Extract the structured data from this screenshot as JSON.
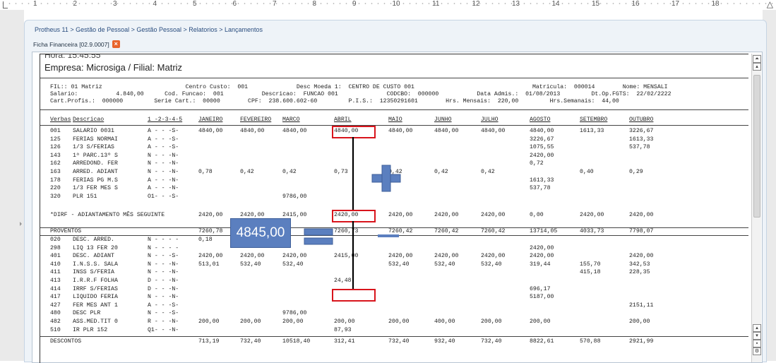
{
  "ruler": {
    "labels": [
      "1",
      "2",
      "3",
      "4",
      "5",
      "6",
      "7",
      "8",
      "9",
      "10",
      "11",
      "12",
      "13",
      "14",
      "15",
      "16",
      "17",
      "18"
    ]
  },
  "breadcrumb": "Protheus 11 > Gestão de Pessoal > Gestão Pessoal > Relatorios > Lançamentos",
  "tab": {
    "label": "Ficha Financeira [02.9.0007]",
    "close": "×"
  },
  "report": {
    "top_cut": "Hora: 15:45:55",
    "empresa": "Empresa: Microsiga / Filial: Matriz",
    "info_lines": [
      "FIL:: 01 Matriz                        Centro Custo:  001              Desc Moeda 1:  CENTRO DE CUSTO 001                                  Matricula:  000014        Nome: MENSALI",
      "Salario:           4.840,00      Cod. Funcao:  001           Descricao:  FUNCAO 001              CODCBO:  000000           Data Admis.:  01/08/2013         Dt.Op.FGTS:  22/02/2222",
      "Cart.Profis.:  000000         Serie Cart.:  00000        CPF:  238.600.602-60         P.I.S.:  12350291601        Hrs. Mensais:  220,00         Hrs.Semanais:  44,00"
    ],
    "headers": [
      "Verbas",
      "Descricao",
      "1 -2-3-4-5",
      "JANEIRO",
      "FEVEREIRO",
      "MARCO",
      "ABRIL",
      "MAIO",
      "JUNHO",
      "JULHO",
      "AGOSTO",
      "SETEMBRO",
      "OUTUBRO"
    ],
    "proventos_rows": [
      [
        "001",
        "SALARIO 0031",
        "A - - -S-",
        "4840,00",
        "4840,00",
        "4840,00",
        "4840,00",
        "4840,00",
        "4840,00",
        "4840,00",
        "4840,00",
        "1613,33",
        "3226,67"
      ],
      [
        "125",
        "FERIAS NORMAI",
        "A - - -S-",
        "",
        "",
        "",
        "",
        "",
        "",
        "",
        "3226,67",
        "",
        "1613,33"
      ],
      [
        "126",
        "1/3 S/FERIAS",
        "A - - -S-",
        "",
        "",
        "",
        "",
        "",
        "",
        "",
        "1075,55",
        "",
        "537,78"
      ],
      [
        "143",
        "1ª PARC.13º S",
        "N - - -N-",
        "",
        "",
        "",
        "",
        "",
        "",
        "",
        "2420,00",
        "",
        ""
      ],
      [
        "162",
        "ARREDOND. FER",
        "N - - -N-",
        "",
        "",
        "",
        "",
        "",
        "",
        "",
        "0,72",
        "",
        ""
      ],
      [
        "163",
        "ARRED. ADIANT",
        "N - - -N-",
        "0,78",
        "0,42",
        "0,42",
        "0,73",
        "0,42",
        "0,42",
        "0,42",
        "",
        "0,40",
        "0,29"
      ],
      [
        "178",
        "FERIAS PG M.S",
        "A - - -N-",
        "",
        "",
        "",
        "",
        "",
        "",
        "",
        "1613,33",
        "",
        ""
      ],
      [
        "220",
        "1/3 FER MES S",
        "A - - -N-",
        "",
        "",
        "",
        "",
        "",
        "",
        "",
        "537,78",
        "",
        ""
      ],
      [
        "320",
        "PLR 151",
        "O1- - -S-",
        "",
        "",
        "9786,00",
        "",
        "",
        "",
        "",
        "",
        "",
        ""
      ]
    ],
    "dirf_row": [
      "*DIRF - ADIANTAMENTO MÊS SEGUINTE",
      "2420,00",
      "2420,00",
      "2415,00",
      "2420,00",
      "2420,00",
      "2420,00",
      "2420,00",
      "0,00",
      "2420,00",
      "2420,00"
    ],
    "proventos_total": [
      "PROVENTOS",
      "7260,78",
      "7260,42",
      "17",
      "7260,73",
      "7260,42",
      "7260,42",
      "7260,42",
      "13714,05",
      "4033,73",
      "7798,07"
    ],
    "descontos_rows": [
      [
        "020",
        "DESC. ARRED.",
        "N - - - -",
        "0,18",
        "",
        "",
        "",
        "",
        "",
        "",
        "",
        "",
        ""
      ],
      [
        "298",
        "LIQ 13 FER 20",
        "N - - - -",
        "",
        "",
        "",
        "",
        "",
        "",
        "",
        "2420,00",
        "",
        ""
      ],
      [
        "401",
        "DESC. ADIANT",
        "N - - -S-",
        "2420,00",
        "2420,00",
        "2420,00",
        "2415,00",
        "2420,00",
        "2420,00",
        "2420,00",
        "2420,00",
        "",
        "2420,00"
      ],
      [
        "410",
        "I.N.S.S. SALA",
        "N - - -N-",
        "513,01",
        "532,40",
        "532,40",
        "",
        "532,40",
        "532,40",
        "532,40",
        "319,44",
        "155,70",
        "342,53"
      ],
      [
        "411",
        "INSS S/FERIA",
        "N - - -N-",
        "",
        "",
        "",
        "",
        "",
        "",
        "",
        "",
        "415,18",
        "228,35"
      ],
      [
        "413",
        "I.R.R.F FOLHA",
        "D - - -N-",
        "",
        "",
        "",
        "24,48",
        "",
        "",
        "",
        "",
        "",
        ""
      ],
      [
        "414",
        "IRRF S/FERIAS",
        "D - - -N-",
        "",
        "",
        "",
        "",
        "",
        "",
        "",
        "696,17",
        "",
        ""
      ],
      [
        "417",
        "LIQUIDO FERIA",
        "N - - -N-",
        "",
        "",
        "",
        "",
        "",
        "",
        "",
        "5187,00",
        "",
        ""
      ],
      [
        "427",
        "FER MES ANT 1",
        "A - - -S-",
        "",
        "",
        "",
        "",
        "",
        "",
        "",
        "",
        "",
        "2151,11"
      ],
      [
        "480",
        "DESC PLR",
        "N - - -S-",
        "",
        "",
        "9786,00",
        "",
        "",
        "",
        "",
        "",
        "",
        ""
      ],
      [
        "482",
        "ASS.MED.TIT 0",
        "R - - -N-",
        "200,00",
        "200,00",
        "200,00",
        "200,00",
        "200,00",
        "400,00",
        "200,00",
        "200,00",
        "",
        "200,00"
      ],
      [
        "510",
        "IR PLR 152",
        "Q1- - -N-",
        "",
        "",
        "",
        "87,93",
        "",
        "",
        "",
        "",
        "",
        ""
      ]
    ],
    "descontos_total": [
      "DESCONTOS",
      "713,19",
      "732,40",
      "10518,40",
      "312,41",
      "732,40",
      "932,40",
      "732,40",
      "8822,61",
      "570,88",
      "2921,99"
    ]
  },
  "annotation": {
    "big_value": "4845,00",
    "color_box": "#5b7fbf",
    "color_red": "#d8141c"
  }
}
